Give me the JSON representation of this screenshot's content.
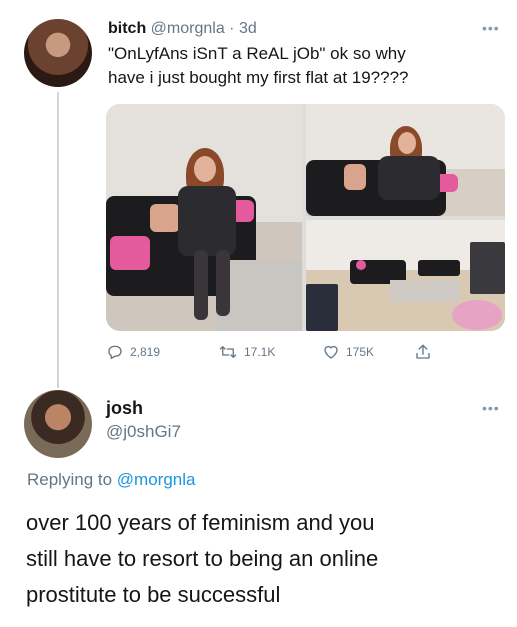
{
  "tweet": {
    "author_name": "bitch",
    "author_handle": "@morgnla",
    "time": "3d",
    "text_line1": "\"OnLyfAns iSnT a ReAL jOb\" ok so why",
    "text_line2": "have i just bought my first flat at 19????",
    "more_icon": "ellipsis-icon",
    "actions": {
      "replies": "2,819",
      "retweets": "17.1K",
      "likes": "175K"
    }
  },
  "reply": {
    "author_name": "josh",
    "author_handle": "@j0shGi7",
    "replying_prefix": "Replying to",
    "replying_mention": "@morgnla",
    "text_line1": "over 100 years of feminism and you",
    "text_line2": "still have to resort to being an online",
    "text_line3": "prostitute to be successful"
  },
  "colors": {
    "text": "#14171a",
    "secondary": "#657786",
    "link": "#1b95e0",
    "thread_line": "#cfd6dc"
  }
}
